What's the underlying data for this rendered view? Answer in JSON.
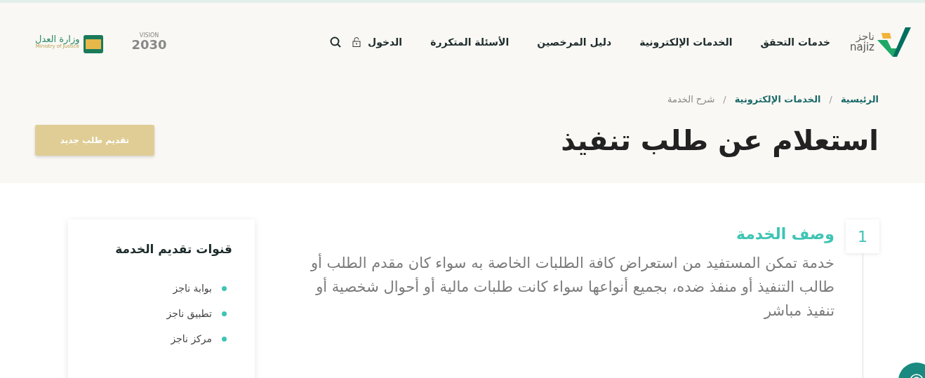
{
  "header": {
    "logo": {
      "arabic": "ناجز",
      "latin": "najiz"
    },
    "nav": [
      {
        "label": "خدمات التحقق"
      },
      {
        "label": "الخدمات الإلكترونية"
      },
      {
        "label": "دليل المرخصين"
      },
      {
        "label": "الأسئلة المتكررة"
      }
    ],
    "login": {
      "label": "الدخول"
    },
    "vision_logo": {
      "word": "VISION",
      "year": "2030"
    },
    "ministry_logo": {
      "arabic": "وزارة العدل",
      "latin": "Ministry of Justice"
    }
  },
  "breadcrumb_separator": "/",
  "breadcrumb": [
    {
      "label": "الرئيسية",
      "kind": "link"
    },
    {
      "label": "الخدمات الإلكترونية",
      "kind": "link"
    },
    {
      "label": "شرح الخدمة",
      "kind": "current"
    }
  ],
  "page_title": "استعلام عن طلب تنفيذ",
  "new_request_button": "تقديم طلب جديد",
  "steps": [
    {
      "number": "1",
      "title": "وصف الخدمة",
      "description": "خدمة تمكن المستفيد من استعراض كافة الطلبات الخاصة به سواء كان مقدم الطلب أو طالب التنفيذ أو منفذ ضده، بجميع أنواعها سواء كانت طلبات مالية أو أحوال شخصية أو تنفيذ مباشر"
    }
  ],
  "channels": {
    "title": "قنوات تقديم الخدمة",
    "items": [
      {
        "label": "بوابة ناجز"
      },
      {
        "label": "تطبيق ناجز"
      },
      {
        "label": "مركز ناجز"
      }
    ]
  }
}
